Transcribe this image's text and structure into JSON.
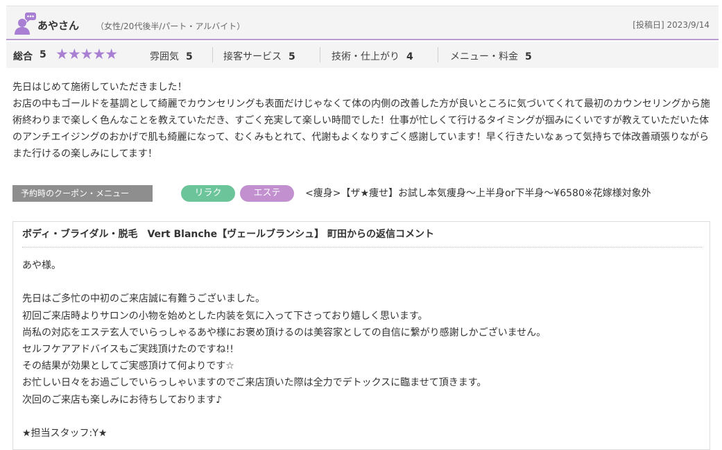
{
  "reviewer": {
    "name": "あやさん",
    "attributes": "（女性/20代後半/パート・アルバイト）",
    "post_date": "[投稿日] 2023/9/14"
  },
  "ratings": {
    "overall_label": "総合",
    "overall_score": "5",
    "stars_filled": 5,
    "stars_text": "★★★★★",
    "categories": [
      {
        "label": "雰囲気",
        "score": "5"
      },
      {
        "label": "接客サービス",
        "score": "5"
      },
      {
        "label": "技術・仕上がり",
        "score": "4"
      },
      {
        "label": "メニュー・料金",
        "score": "5"
      }
    ]
  },
  "review": {
    "line1": "先日はじめて施術していただきました！",
    "line2": "お店の中もゴールドを基調として綺麗でカウンセリングも表面だけじゃなくて体の内側の改善した方が良いところに気づいてくれて最初のカウンセリングから施術終わりまで楽しく色んなことを教えていただき、すごく充実して楽しい時間でした！仕事が忙しくて行けるタイミングが掴みにくいですが教えていただいた体のアンチエイジングのおかげで肌も綺麗になって、むくみもとれて、代謝もよくなりすごく感謝しています！早く行きたいなぁって気持ちで体改善頑張りながらまた行けるの楽しみにしてます！"
  },
  "coupon": {
    "label": "予約時のクーポン・メニュー",
    "tags": [
      "リラク",
      "エステ"
    ],
    "menu_name": "<痩身>【ザ★痩せ】お試し本気痩身～上半身or下半身～¥6580※花嫁様対象外"
  },
  "reply": {
    "title": "ボディ・ブライダル・脱毛　Vert Blanche【ヴェールブランシュ】 町田からの返信コメント",
    "lines": [
      "あや様。",
      "",
      "先日はご多忙の中初のご来店誠に有難うございました。",
      "初回ご来店時よりサロンの小物を始めとした内装を気に入って下さっており嬉しく思います。",
      "尚私の対応をエステ玄人でいらっしゃるあや様にお褒め頂けるのは美容家としての自信に繋がり感謝しかございません。",
      "セルフケアアドバイスもご実践頂けたのですね!!",
      "その結果が効果としてご実感頂けて何よりです☆",
      "お忙しい日々をお過ごしでいらっしゃいますのでご来店頂いた際は全力でデトックスに臨ませて頂きます。",
      "次回のご来店も楽しみにお待ちしております♪",
      "",
      "★担当スタッフ:Y★"
    ]
  },
  "colors": {
    "accent_purple": "#a97fd3",
    "tag_relax": "#6cc59a",
    "tag_este": "#c290cf",
    "coupon_label_bg": "#8e8e8e"
  },
  "icons": {
    "avatar": "user-comment-icon"
  }
}
